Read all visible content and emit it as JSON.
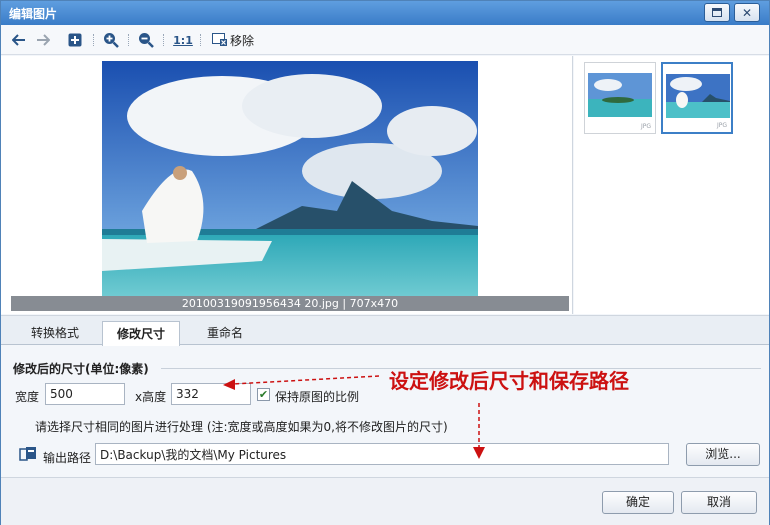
{
  "window": {
    "title": "编辑图片"
  },
  "toolbar": {
    "remove_label": "移除",
    "ratio_label": "1:1"
  },
  "preview": {
    "caption": "20100319091956434 20.jpg | 707x470"
  },
  "thumbnails": [
    {
      "type": "JPG"
    },
    {
      "type": "JPG"
    }
  ],
  "tabs": [
    {
      "label": "转换格式"
    },
    {
      "label": "修改尺寸"
    },
    {
      "label": "重命名"
    }
  ],
  "resize": {
    "section_title": "修改后的尺寸(单位:像素)",
    "width_label": "宽度",
    "width_value": "500",
    "height_label": "x高度",
    "height_value": "332",
    "keep_ratio_label": "保持原图的比例",
    "note": "请选择尺寸相同的图片进行处理 (注:宽度或高度如果为0,将不修改图片的尺寸)",
    "output_label": "输出路径",
    "output_path": "D:\\Backup\\我的文档\\My Pictures",
    "browse_label": "浏览..."
  },
  "annotation": {
    "text": "设定修改后尺寸和保存路径",
    "color": "#cc1111"
  },
  "footer": {
    "ok_label": "确定",
    "cancel_label": "取消"
  }
}
